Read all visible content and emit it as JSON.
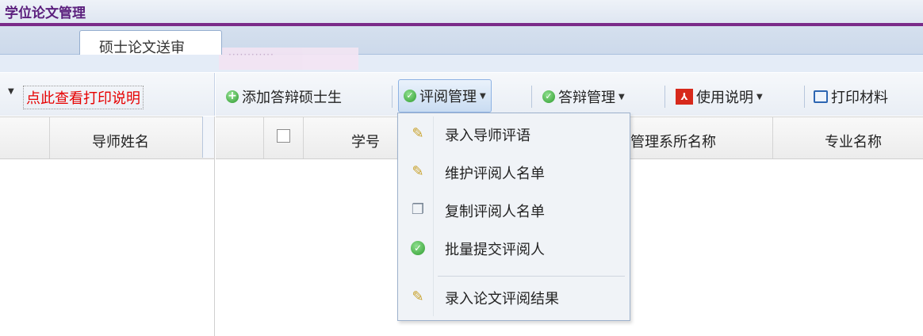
{
  "app": {
    "title": "学位论文管理"
  },
  "tabs": {
    "active": "硕士论文送审",
    "sub": "············"
  },
  "left_panel": {
    "print_link": "点此查看打印说明",
    "columns": [
      "导师姓名"
    ]
  },
  "toolbar": {
    "add_student": "添加答辩硕士生",
    "review_mgmt": "评阅管理",
    "defense_mgmt": "答辩管理",
    "usage_guide": "使用说明",
    "print_materials": "打印材料"
  },
  "grid": {
    "columns": [
      "学号",
      "管理系所名称",
      "专业名称"
    ]
  },
  "review_menu": {
    "items": [
      {
        "label": "录入导师评语",
        "icon": "pencil-icon"
      },
      {
        "label": "维护评阅人名单",
        "icon": "pencil-icon"
      },
      {
        "label": "复制评阅人名单",
        "icon": "copy-icon"
      },
      {
        "label": "批量提交评阅人",
        "icon": "check-circle-icon"
      },
      {
        "label": "录入论文评阅结果",
        "icon": "pencil-icon"
      }
    ]
  },
  "colors": {
    "accent": "#7a2b89",
    "link_red": "#e60000",
    "menu_bg": "#f0f3f7"
  }
}
